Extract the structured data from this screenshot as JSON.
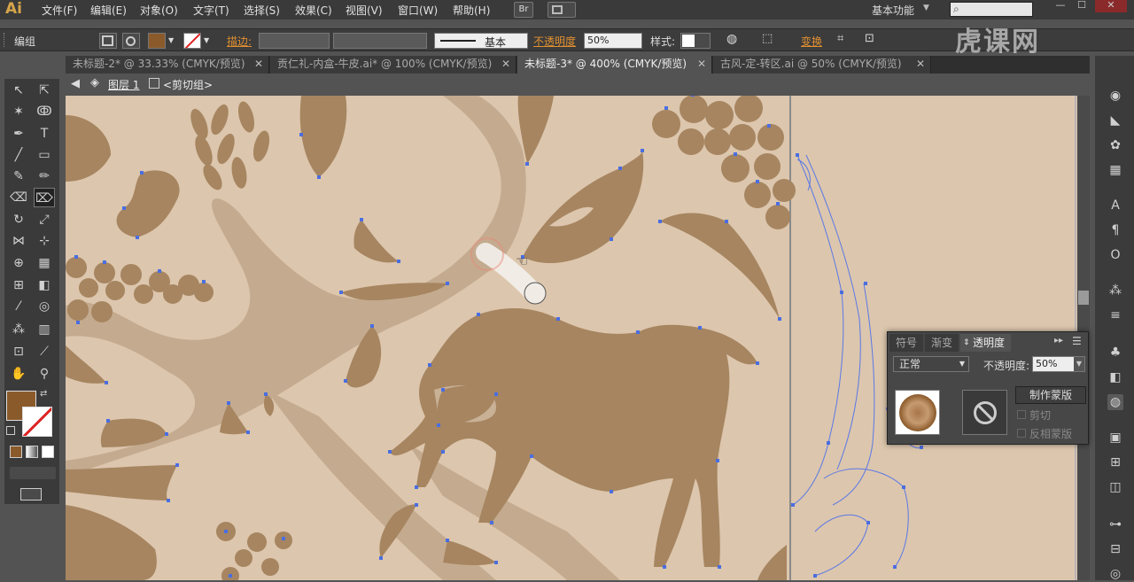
{
  "app": {
    "logo": "Ai"
  },
  "menus": [
    "文件(F)",
    "编辑(E)",
    "对象(O)",
    "文字(T)",
    "选择(S)",
    "效果(C)",
    "视图(V)",
    "窗口(W)",
    "帮助(H)"
  ],
  "menubar": {
    "bridge": "Br",
    "workspace": "基本功能"
  },
  "control": {
    "selection": "编组",
    "stroke_label": "描边:",
    "stroke_style": "基本",
    "opacity_label": "不透明度",
    "opacity_value": "50%",
    "style_label": "样式:",
    "transform_label": "变换"
  },
  "tabs": [
    {
      "label": "未标题-2* @ 33.33% (CMYK/预览)",
      "active": false
    },
    {
      "label": "贡仁礼-内盒-牛皮.ai* @ 100% (CMYK/预览)",
      "active": false
    },
    {
      "label": "未标题-3* @ 400% (CMYK/预览)",
      "active": true
    },
    {
      "label": "古风-定-转区.ai @ 50% (CMYK/预览)",
      "active": false
    }
  ],
  "breadcrumb": {
    "layer": "图层 1",
    "group": "<剪切组>"
  },
  "transparency_panel": {
    "tabs": [
      "符号",
      "渐变",
      "透明度"
    ],
    "blend_mode": "正常",
    "opacity_label": "不透明度:",
    "opacity_value": "50%",
    "make_mask_button": "制作蒙版",
    "clip_label": "剪切",
    "invert_label": "反相蒙版"
  },
  "watermark": "虎课网",
  "colors": {
    "fill": "#8b5a2b",
    "canvas": "#dcc6ad",
    "shape": "#a68560",
    "anchor": "#4a6ee0",
    "accent": "#e09030"
  }
}
